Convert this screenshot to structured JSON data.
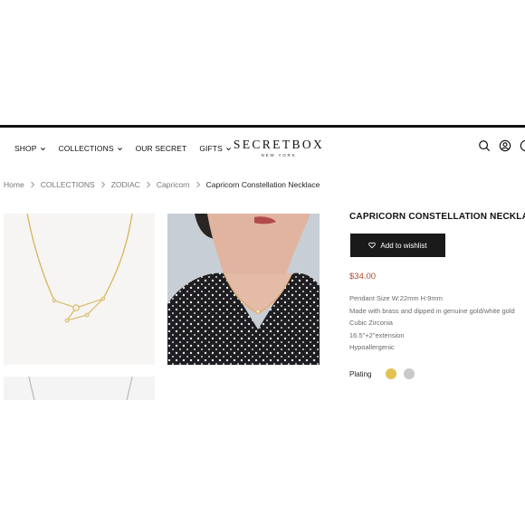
{
  "header": {
    "nav": [
      {
        "label": "SHOP",
        "dropdown": true
      },
      {
        "label": "COLLECTIONS",
        "dropdown": true
      },
      {
        "label": "OUR SECRET",
        "dropdown": false
      },
      {
        "label": "GIFTS",
        "dropdown": true
      }
    ],
    "brand": "SECRETBOX",
    "brand_sub": "NEW YORK",
    "icons": [
      "search-icon",
      "account-icon",
      "cart-icon"
    ]
  },
  "breadcrumb": [
    "Home",
    "COLLECTIONS",
    "ZODIAC",
    "Capricorn",
    "Capricorn Constellation Necklace"
  ],
  "product": {
    "title": "CAPRICORN CONSTELLATION NECKLACE",
    "wishlist_label": "Add to wishlist",
    "price": "$34.00",
    "specs": [
      "Pendant Size W:22mm H:9mm",
      "Made with brass and dipped in genuine gold/white gold",
      "Cubic Zirconia",
      "16.5\"+2\"extension",
      "Hypoallergenic"
    ],
    "plating_label": "Plating",
    "plating_options": [
      {
        "name": "gold",
        "color": "#e3c052"
      },
      {
        "name": "silver",
        "color": "#c9c9c9"
      }
    ]
  },
  "colors": {
    "accent_price": "#b5482f",
    "button_bg": "#1a1a1a"
  }
}
